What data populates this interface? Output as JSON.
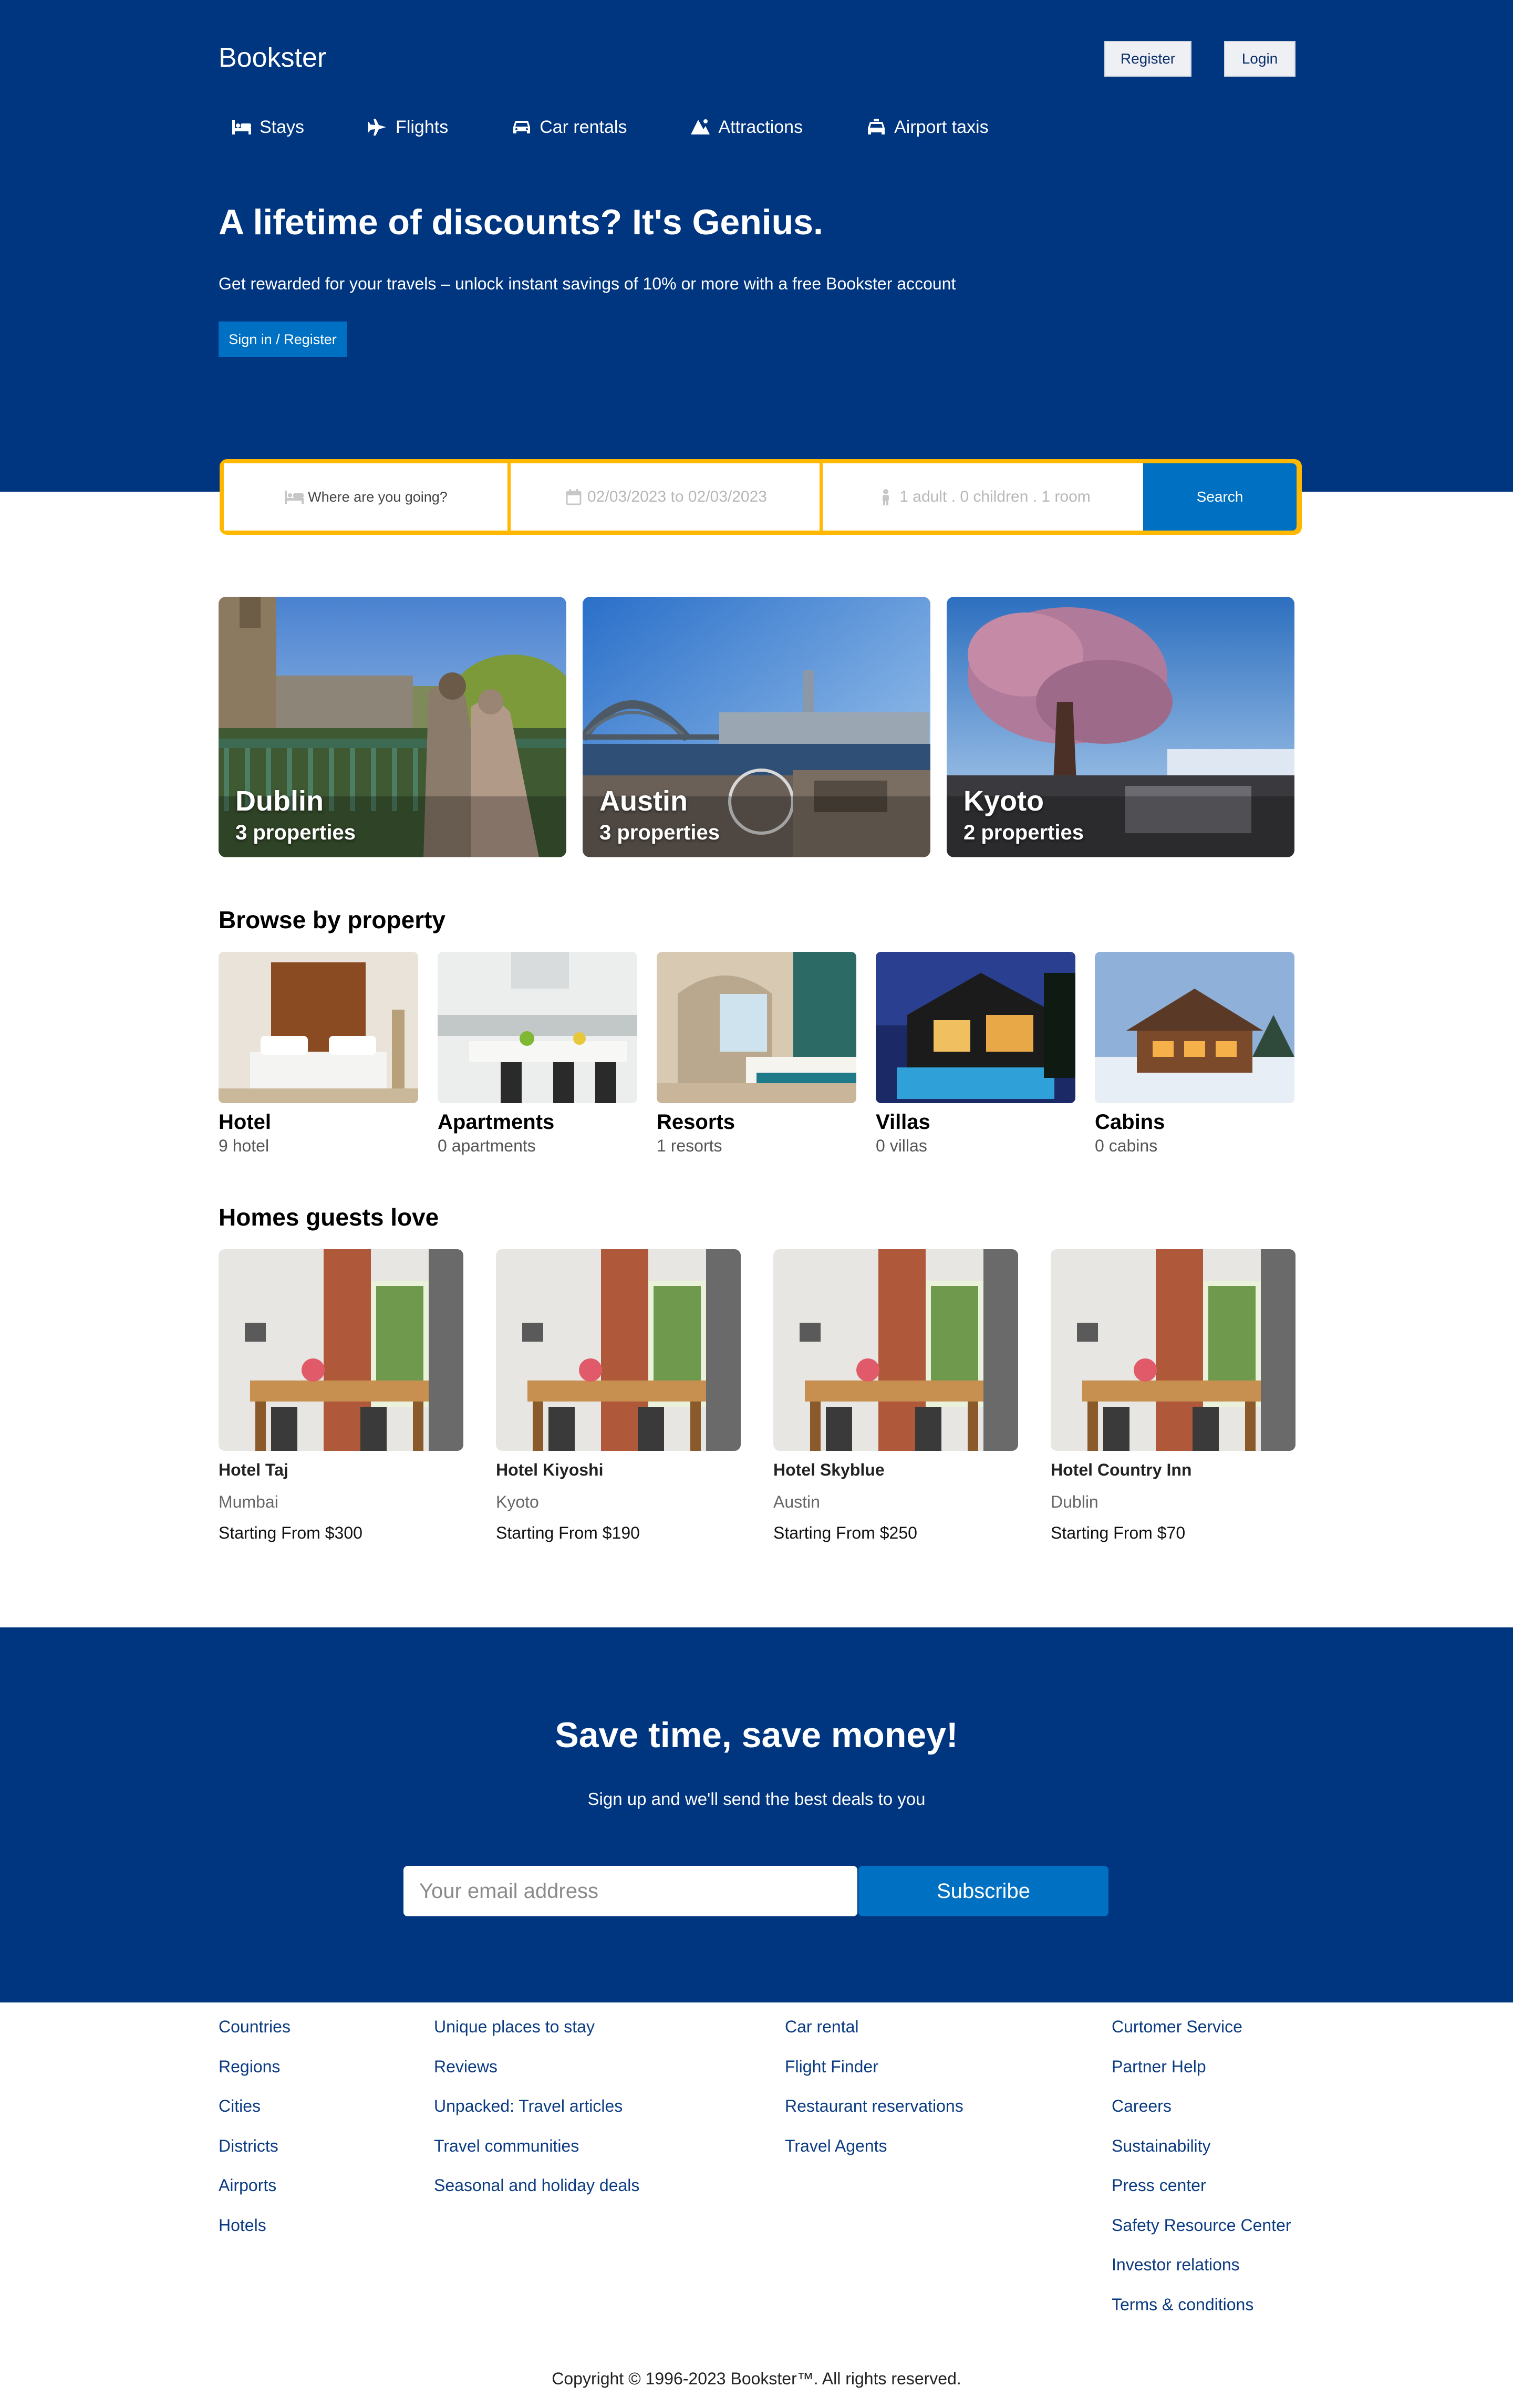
{
  "header": {
    "brand": "Bookster",
    "register": "Register",
    "login": "Login",
    "nav": [
      {
        "label": "Stays",
        "icon": "bed-icon"
      },
      {
        "label": "Flights",
        "icon": "plane-icon"
      },
      {
        "label": "Car rentals",
        "icon": "car-icon"
      },
      {
        "label": "Attractions",
        "icon": "attractions-icon"
      },
      {
        "label": "Airport taxis",
        "icon": "taxi-icon"
      }
    ],
    "title": "A lifetime of discounts? It's Genius.",
    "subtitle": "Get rewarded for your travels – unlock instant savings of 10% or more with a free Bookster account",
    "cta": "Sign in / Register"
  },
  "search": {
    "destination_placeholder": "Where are you going?",
    "dates": "02/03/2023 to 02/03/2023",
    "guests": "1 adult . 0 children . 1 room",
    "button": "Search"
  },
  "featured": [
    {
      "city": "Dublin",
      "properties": "3 properties"
    },
    {
      "city": "Austin",
      "properties": "3 properties"
    },
    {
      "city": "Kyoto",
      "properties": "2 properties"
    }
  ],
  "browse": {
    "title": "Browse by property",
    "items": [
      {
        "label": "Hotel",
        "count": "9 hotel"
      },
      {
        "label": "Apartments",
        "count": "0 apartments"
      },
      {
        "label": "Resorts",
        "count": "1 resorts"
      },
      {
        "label": "Villas",
        "count": "0 villas"
      },
      {
        "label": "Cabins",
        "count": "0 cabins"
      }
    ]
  },
  "homes": {
    "title": "Homes guests love",
    "items": [
      {
        "name": "Hotel Taj",
        "city": "Mumbai",
        "price": "Starting From $300"
      },
      {
        "name": "Hotel Kiyoshi",
        "city": "Kyoto",
        "price": "Starting From $190"
      },
      {
        "name": "Hotel Skyblue",
        "city": "Austin",
        "price": "Starting From $250"
      },
      {
        "name": "Hotel Country Inn",
        "city": "Dublin",
        "price": "Starting From $70"
      }
    ]
  },
  "newsletter": {
    "title": "Save time, save money!",
    "subtitle": "Sign up and we'll send the best deals to you",
    "email_placeholder": "Your email address",
    "button": "Subscribe"
  },
  "footer": {
    "col1": [
      "Countries",
      "Regions",
      "Cities",
      "Districts",
      "Airports",
      "Hotels"
    ],
    "col2": [
      "Unique places to stay",
      "Reviews",
      "Unpacked: Travel articles",
      "Travel communities",
      "Seasonal and holiday deals"
    ],
    "col3": [
      "Car rental",
      "Flight Finder",
      "Restaurant reservations",
      "Travel Agents"
    ],
    "col4": [
      "Curtomer Service",
      "Partner Help",
      "Careers",
      "Sustainability",
      "Press center",
      "Safety Resource Center",
      "Investor relations",
      "Terms & conditions"
    ],
    "copyright": "Copyright © 1996-2023 Bookster™. All rights reserved."
  },
  "colors": {
    "primary": "#003580",
    "accent": "#0071c2",
    "search_border": "#ffb700"
  }
}
